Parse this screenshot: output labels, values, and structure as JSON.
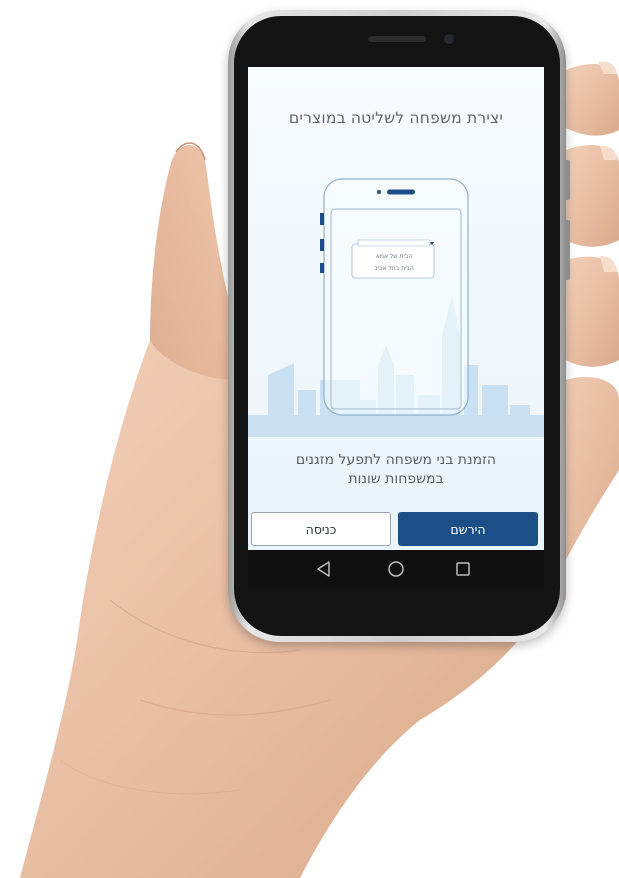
{
  "screen": {
    "title": "יצירת משפחה לשליטה במוצרים",
    "illustration": {
      "dropdown_items": [
        "הבית של אמא",
        "הבית בתל אביב"
      ]
    },
    "subtitle_line1": "הזמנת בני משפחה לתפעל מזגנים",
    "subtitle_line2": "במשפחות שונות",
    "register_label": "הירשם",
    "login_label": "כניסה"
  },
  "navbar": {
    "back_icon": "back-triangle-icon",
    "home_icon": "home-circle-icon",
    "recents_icon": "recents-square-icon"
  },
  "colors": {
    "primary": "#1c4f88",
    "screen_bg": "#eaf4fb",
    "skyline": "#c9e0f2",
    "text": "#5e6470"
  }
}
